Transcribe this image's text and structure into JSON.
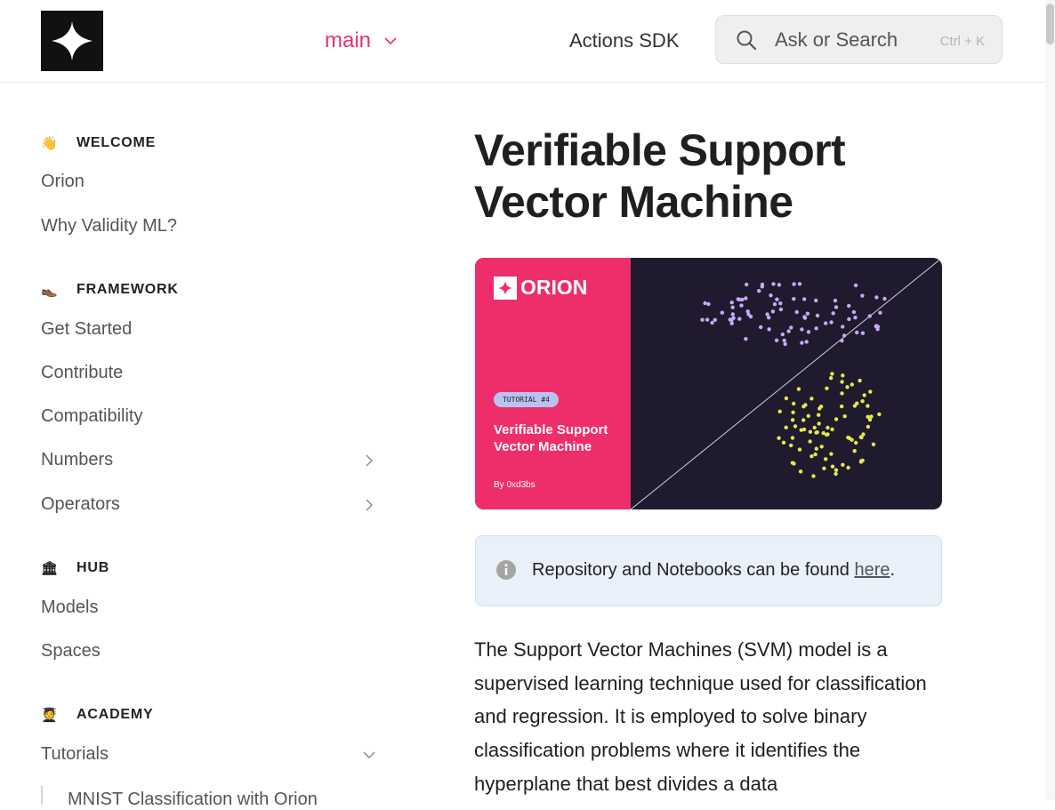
{
  "header": {
    "logo": "orion-logo",
    "version_label": "main",
    "sdk_link": "Actions SDK",
    "search": {
      "placeholder": "Ask or Search",
      "shortcut": "Ctrl + K"
    }
  },
  "sidebar": {
    "sections": [
      {
        "emoji": "👋",
        "title": "WELCOME",
        "items": [
          "Orion",
          "Why Validity ML?"
        ]
      },
      {
        "emoji": "👞",
        "title": "FRAMEWORK",
        "items": [
          "Get Started",
          "Contribute",
          "Compatibility",
          "Numbers",
          "Operators"
        ]
      },
      {
        "emoji": "🏛",
        "title": "HUB",
        "items": [
          "Models",
          "Spaces"
        ]
      },
      {
        "emoji": "🧑‍🎓",
        "title": "ACADEMY",
        "items": [
          "Tutorials"
        ]
      }
    ],
    "sub_item": "MNIST Classification with Orion"
  },
  "main": {
    "title": "Verifiable Support Vector Machine",
    "banner": {
      "brand": "ORION",
      "tag": "TUTORIAL #4",
      "title": "Verifiable Support Vector Machine",
      "author": "By 0xd3bs",
      "colors": {
        "pink": "#ee2e6b",
        "dark": "#1f1a2d",
        "purple_points": "#c9a8f5",
        "yellow_points": "#e6e84a"
      }
    },
    "hint": {
      "prefix": "Repository and Notebooks can be found ",
      "link": "here",
      "suffix": "."
    },
    "paragraph": "The Support Vector Machines (SVM) model is a supervised learning technique used for classification and regression. It is employed to solve binary classification problems where it identifies the hyperplane that best divides a data"
  },
  "colors": {
    "accent": "#e8336d",
    "hint_bg": "#e9f0fa"
  }
}
